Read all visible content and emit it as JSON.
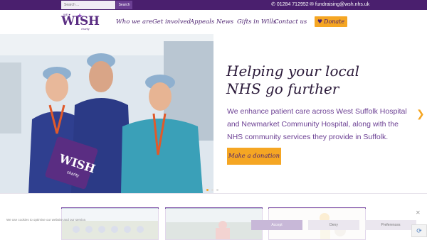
{
  "topbar": {
    "search_placeholder": "Search ...",
    "search_button": "Search",
    "phone": "01284 712952",
    "email": "fundraising@wsh.nhs.uk",
    "phone_icon": "phone-icon",
    "email_icon": "envelope-icon"
  },
  "logo": {
    "wish": "WISH",
    "we_love": "WE ♥",
    "charity": "charity"
  },
  "nav": {
    "items": [
      "Who we are",
      "Get involved",
      "Appeals",
      "News",
      "Gifts in Wills",
      "Contact us"
    ],
    "donate": "Donate"
  },
  "hero": {
    "title": "Helping your local NHS go further",
    "body": "We enhance patient care across West Suffolk Hospital and Newmarket Community Hospital, along with the NHS community services they provide in Suffolk.",
    "cta": "Make a donation",
    "sign_wish": "WISH",
    "sign_charity": "charity"
  },
  "cookie": {
    "text": "We use cookies to optimise our website and our service.",
    "accept": "Accept",
    "deny": "Deny",
    "preferences": "Preferences"
  },
  "colors": {
    "brand_purple": "#4a1f6e",
    "accent_orange": "#f5a623"
  }
}
